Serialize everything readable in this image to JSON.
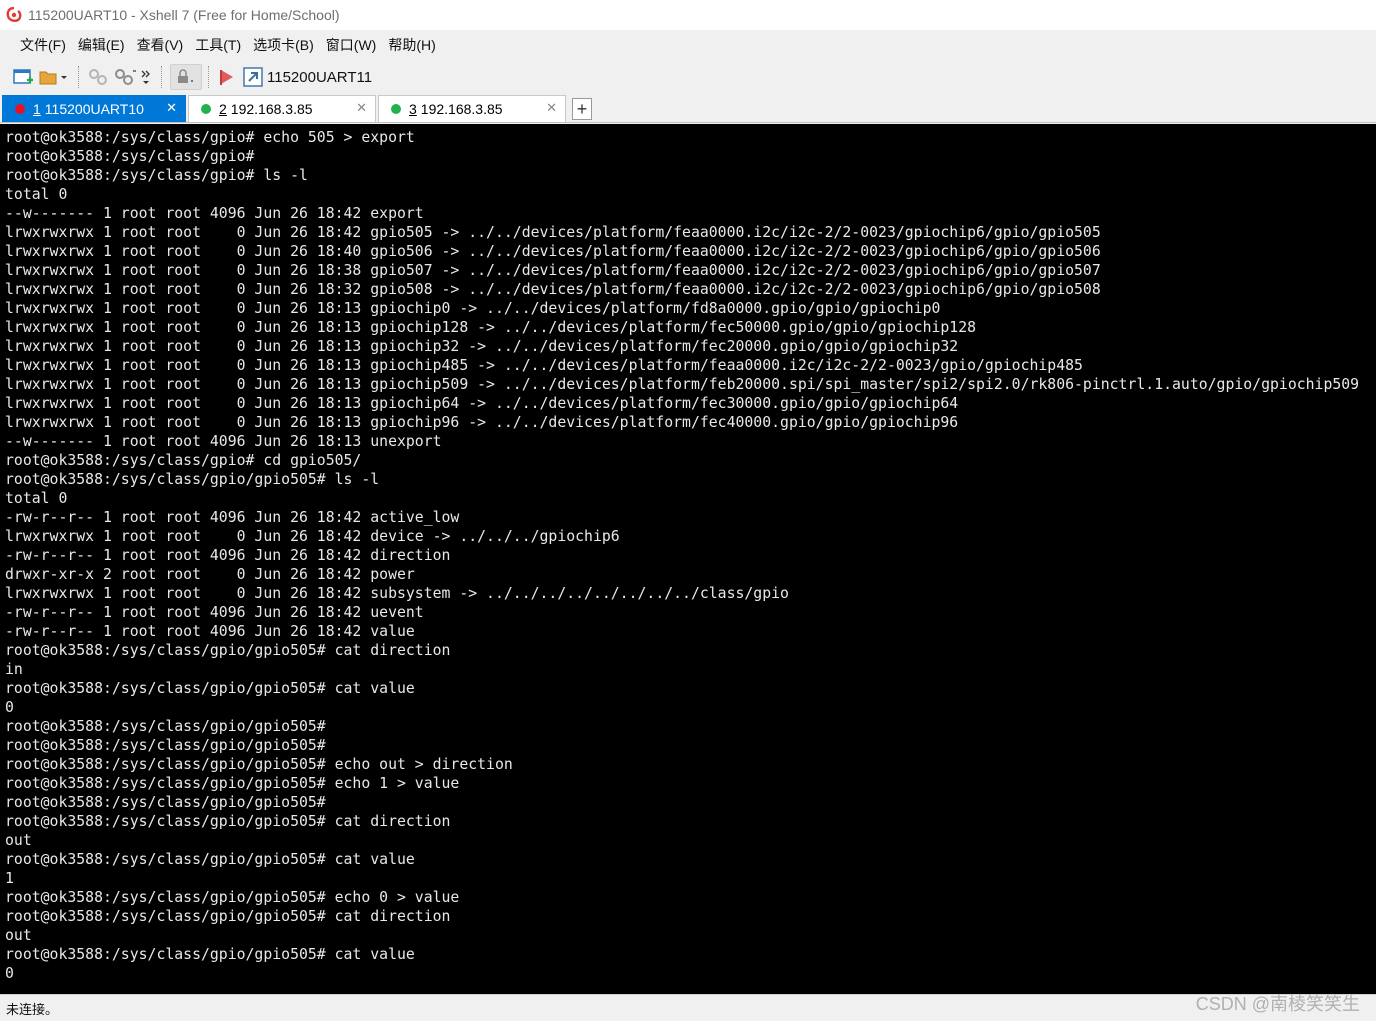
{
  "window": {
    "title": "115200UART10 - Xshell 7 (Free for Home/School)"
  },
  "menu": {
    "items": [
      "文件(F)",
      "编辑(E)",
      "查看(V)",
      "工具(T)",
      "选项卡(B)",
      "窗口(W)",
      "帮助(H)"
    ]
  },
  "toolbar": {
    "session_label": "115200UART11"
  },
  "tabs": [
    {
      "num": "1",
      "label": " 115200UART10",
      "status_color": "#e81123",
      "active": true,
      "close": "✕"
    },
    {
      "num": "2",
      "label": " 192.168.3.85",
      "status_color": "#22b14c",
      "active": false,
      "close": "✕"
    },
    {
      "num": "3",
      "label": " 192.168.3.85",
      "status_color": "#22b14c",
      "active": false,
      "close": "✕"
    }
  ],
  "tab_add_label": "+",
  "terminal": {
    "lines": [
      "root@ok3588:/sys/class/gpio# echo 505 > export",
      "root@ok3588:/sys/class/gpio#",
      "root@ok3588:/sys/class/gpio# ls -l",
      "total 0",
      "--w------- 1 root root 4096 Jun 26 18:42 export",
      "lrwxrwxrwx 1 root root    0 Jun 26 18:42 gpio505 -> ../../devices/platform/feaa0000.i2c/i2c-2/2-0023/gpiochip6/gpio/gpio505",
      "lrwxrwxrwx 1 root root    0 Jun 26 18:40 gpio506 -> ../../devices/platform/feaa0000.i2c/i2c-2/2-0023/gpiochip6/gpio/gpio506",
      "lrwxrwxrwx 1 root root    0 Jun 26 18:38 gpio507 -> ../../devices/platform/feaa0000.i2c/i2c-2/2-0023/gpiochip6/gpio/gpio507",
      "lrwxrwxrwx 1 root root    0 Jun 26 18:32 gpio508 -> ../../devices/platform/feaa0000.i2c/i2c-2/2-0023/gpiochip6/gpio/gpio508",
      "lrwxrwxrwx 1 root root    0 Jun 26 18:13 gpiochip0 -> ../../devices/platform/fd8a0000.gpio/gpio/gpiochip0",
      "lrwxrwxrwx 1 root root    0 Jun 26 18:13 gpiochip128 -> ../../devices/platform/fec50000.gpio/gpio/gpiochip128",
      "lrwxrwxrwx 1 root root    0 Jun 26 18:13 gpiochip32 -> ../../devices/platform/fec20000.gpio/gpio/gpiochip32",
      "lrwxrwxrwx 1 root root    0 Jun 26 18:13 gpiochip485 -> ../../devices/platform/feaa0000.i2c/i2c-2/2-0023/gpio/gpiochip485",
      "lrwxrwxrwx 1 root root    0 Jun 26 18:13 gpiochip509 -> ../../devices/platform/feb20000.spi/spi_master/spi2/spi2.0/rk806-pinctrl.1.auto/gpio/gpiochip509",
      "lrwxrwxrwx 1 root root    0 Jun 26 18:13 gpiochip64 -> ../../devices/platform/fec30000.gpio/gpio/gpiochip64",
      "lrwxrwxrwx 1 root root    0 Jun 26 18:13 gpiochip96 -> ../../devices/platform/fec40000.gpio/gpio/gpiochip96",
      "--w------- 1 root root 4096 Jun 26 18:13 unexport",
      "root@ok3588:/sys/class/gpio# cd gpio505/",
      "root@ok3588:/sys/class/gpio/gpio505# ls -l",
      "total 0",
      "-rw-r--r-- 1 root root 4096 Jun 26 18:42 active_low",
      "lrwxrwxrwx 1 root root    0 Jun 26 18:42 device -> ../../../gpiochip6",
      "-rw-r--r-- 1 root root 4096 Jun 26 18:42 direction",
      "drwxr-xr-x 2 root root    0 Jun 26 18:42 power",
      "lrwxrwxrwx 1 root root    0 Jun 26 18:42 subsystem -> ../../../../../../../../class/gpio",
      "-rw-r--r-- 1 root root 4096 Jun 26 18:42 uevent",
      "-rw-r--r-- 1 root root 4096 Jun 26 18:42 value",
      "root@ok3588:/sys/class/gpio/gpio505# cat direction",
      "in",
      "root@ok3588:/sys/class/gpio/gpio505# cat value",
      "0",
      "root@ok3588:/sys/class/gpio/gpio505#",
      "root@ok3588:/sys/class/gpio/gpio505#",
      "root@ok3588:/sys/class/gpio/gpio505# echo out > direction",
      "root@ok3588:/sys/class/gpio/gpio505# echo 1 > value",
      "root@ok3588:/sys/class/gpio/gpio505#",
      "root@ok3588:/sys/class/gpio/gpio505# cat direction",
      "out",
      "root@ok3588:/sys/class/gpio/gpio505# cat value",
      "1",
      "root@ok3588:/sys/class/gpio/gpio505# echo 0 > value",
      "root@ok3588:/sys/class/gpio/gpio505# cat direction",
      "out",
      "root@ok3588:/sys/class/gpio/gpio505# cat value",
      "0"
    ]
  },
  "status": {
    "text": "未连接。"
  },
  "watermark": "CSDN @南棱笑笑生"
}
